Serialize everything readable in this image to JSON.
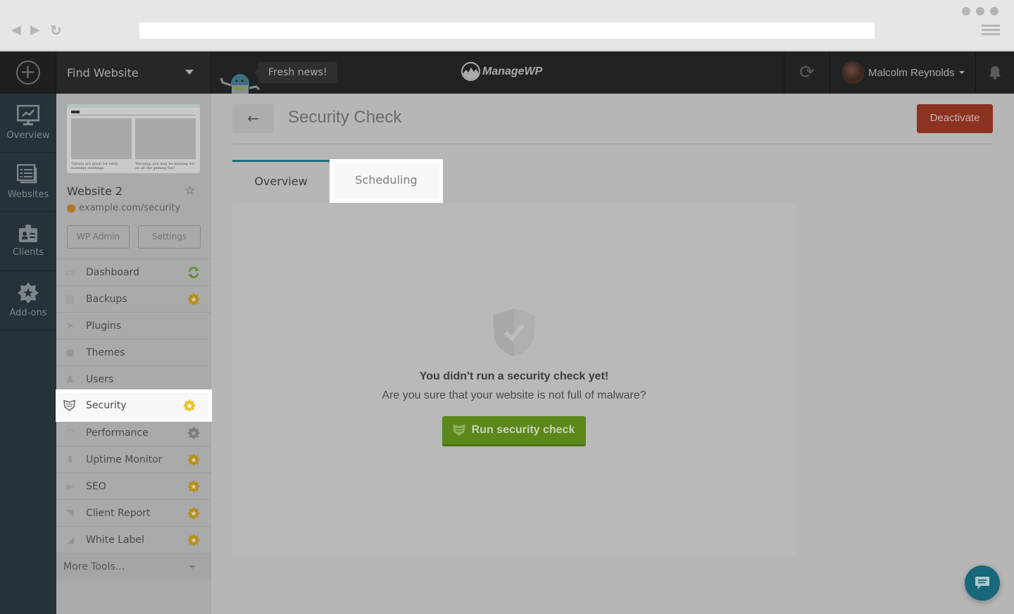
{
  "browser": {
    "back_icon": "triangle-left",
    "forward_icon": "triangle-right",
    "reload_icon": "reload",
    "url": "",
    "window_dots": 3,
    "menu_icon": "hamburger"
  },
  "topbar": {
    "add_icon": "plus-circle",
    "find_website_label": "Find Website",
    "news_label": "Fresh news!",
    "logo_text": "ManageWP",
    "sync_icon": "refresh",
    "user_name": "Malcolm Reynolds",
    "notifications_icon": "bell"
  },
  "leftnav": {
    "items": [
      {
        "label": "Overview",
        "icon": "monitor-chart"
      },
      {
        "label": "Websites",
        "icon": "stacked-list"
      },
      {
        "label": "Clients",
        "icon": "id-badge"
      },
      {
        "label": "Add-ons",
        "icon": "star-badge"
      }
    ]
  },
  "site": {
    "thumbnail_captions": [
      "Tablets are great for early morning meetings",
      "Warning: you may be missing out on all the gaming fun!"
    ],
    "name": "Website 2",
    "url": "example.com/security",
    "wp_admin_label": "WP Admin",
    "settings_label": "Settings"
  },
  "menu": {
    "items": [
      {
        "label": "Dashboard",
        "icon": "monitor",
        "badge": "sync"
      },
      {
        "label": "Backups",
        "icon": "backup-drive",
        "badge": "premium"
      },
      {
        "label": "Plugins",
        "icon": "plug",
        "badge": ""
      },
      {
        "label": "Themes",
        "icon": "palette",
        "badge": ""
      },
      {
        "label": "Users",
        "icon": "user",
        "badge": ""
      },
      {
        "label": "Security",
        "icon": "shield",
        "badge": "premium",
        "active": true
      },
      {
        "label": "Performance",
        "icon": "gauge",
        "badge": "premium-inactive"
      },
      {
        "label": "Uptime Monitor",
        "icon": "arrow-up",
        "badge": "premium"
      },
      {
        "label": "SEO",
        "icon": "megaphone",
        "badge": "premium"
      },
      {
        "label": "Client Report",
        "icon": "area-chart",
        "badge": "premium"
      },
      {
        "label": "White Label",
        "icon": "tag",
        "badge": "premium"
      }
    ],
    "more_label": "More Tools..."
  },
  "main": {
    "back_icon": "arrow-left",
    "title": "Security Check",
    "deactivate_label": "Deactivate",
    "tabs": [
      {
        "label": "Overview",
        "active": true
      },
      {
        "label": "Scheduling",
        "highlighted": true
      }
    ],
    "empty_heading": "You didn't run a security check yet!",
    "empty_text": "Are you sure that your website is not full of malware?",
    "run_button_label": "Run security check"
  },
  "colors": {
    "accent_teal": "#1e6e7e",
    "deactivate_red": "#8c3221",
    "run_green": "#5a881a",
    "premium_gold": "#c9a21c",
    "chat_teal": "#17687a"
  }
}
